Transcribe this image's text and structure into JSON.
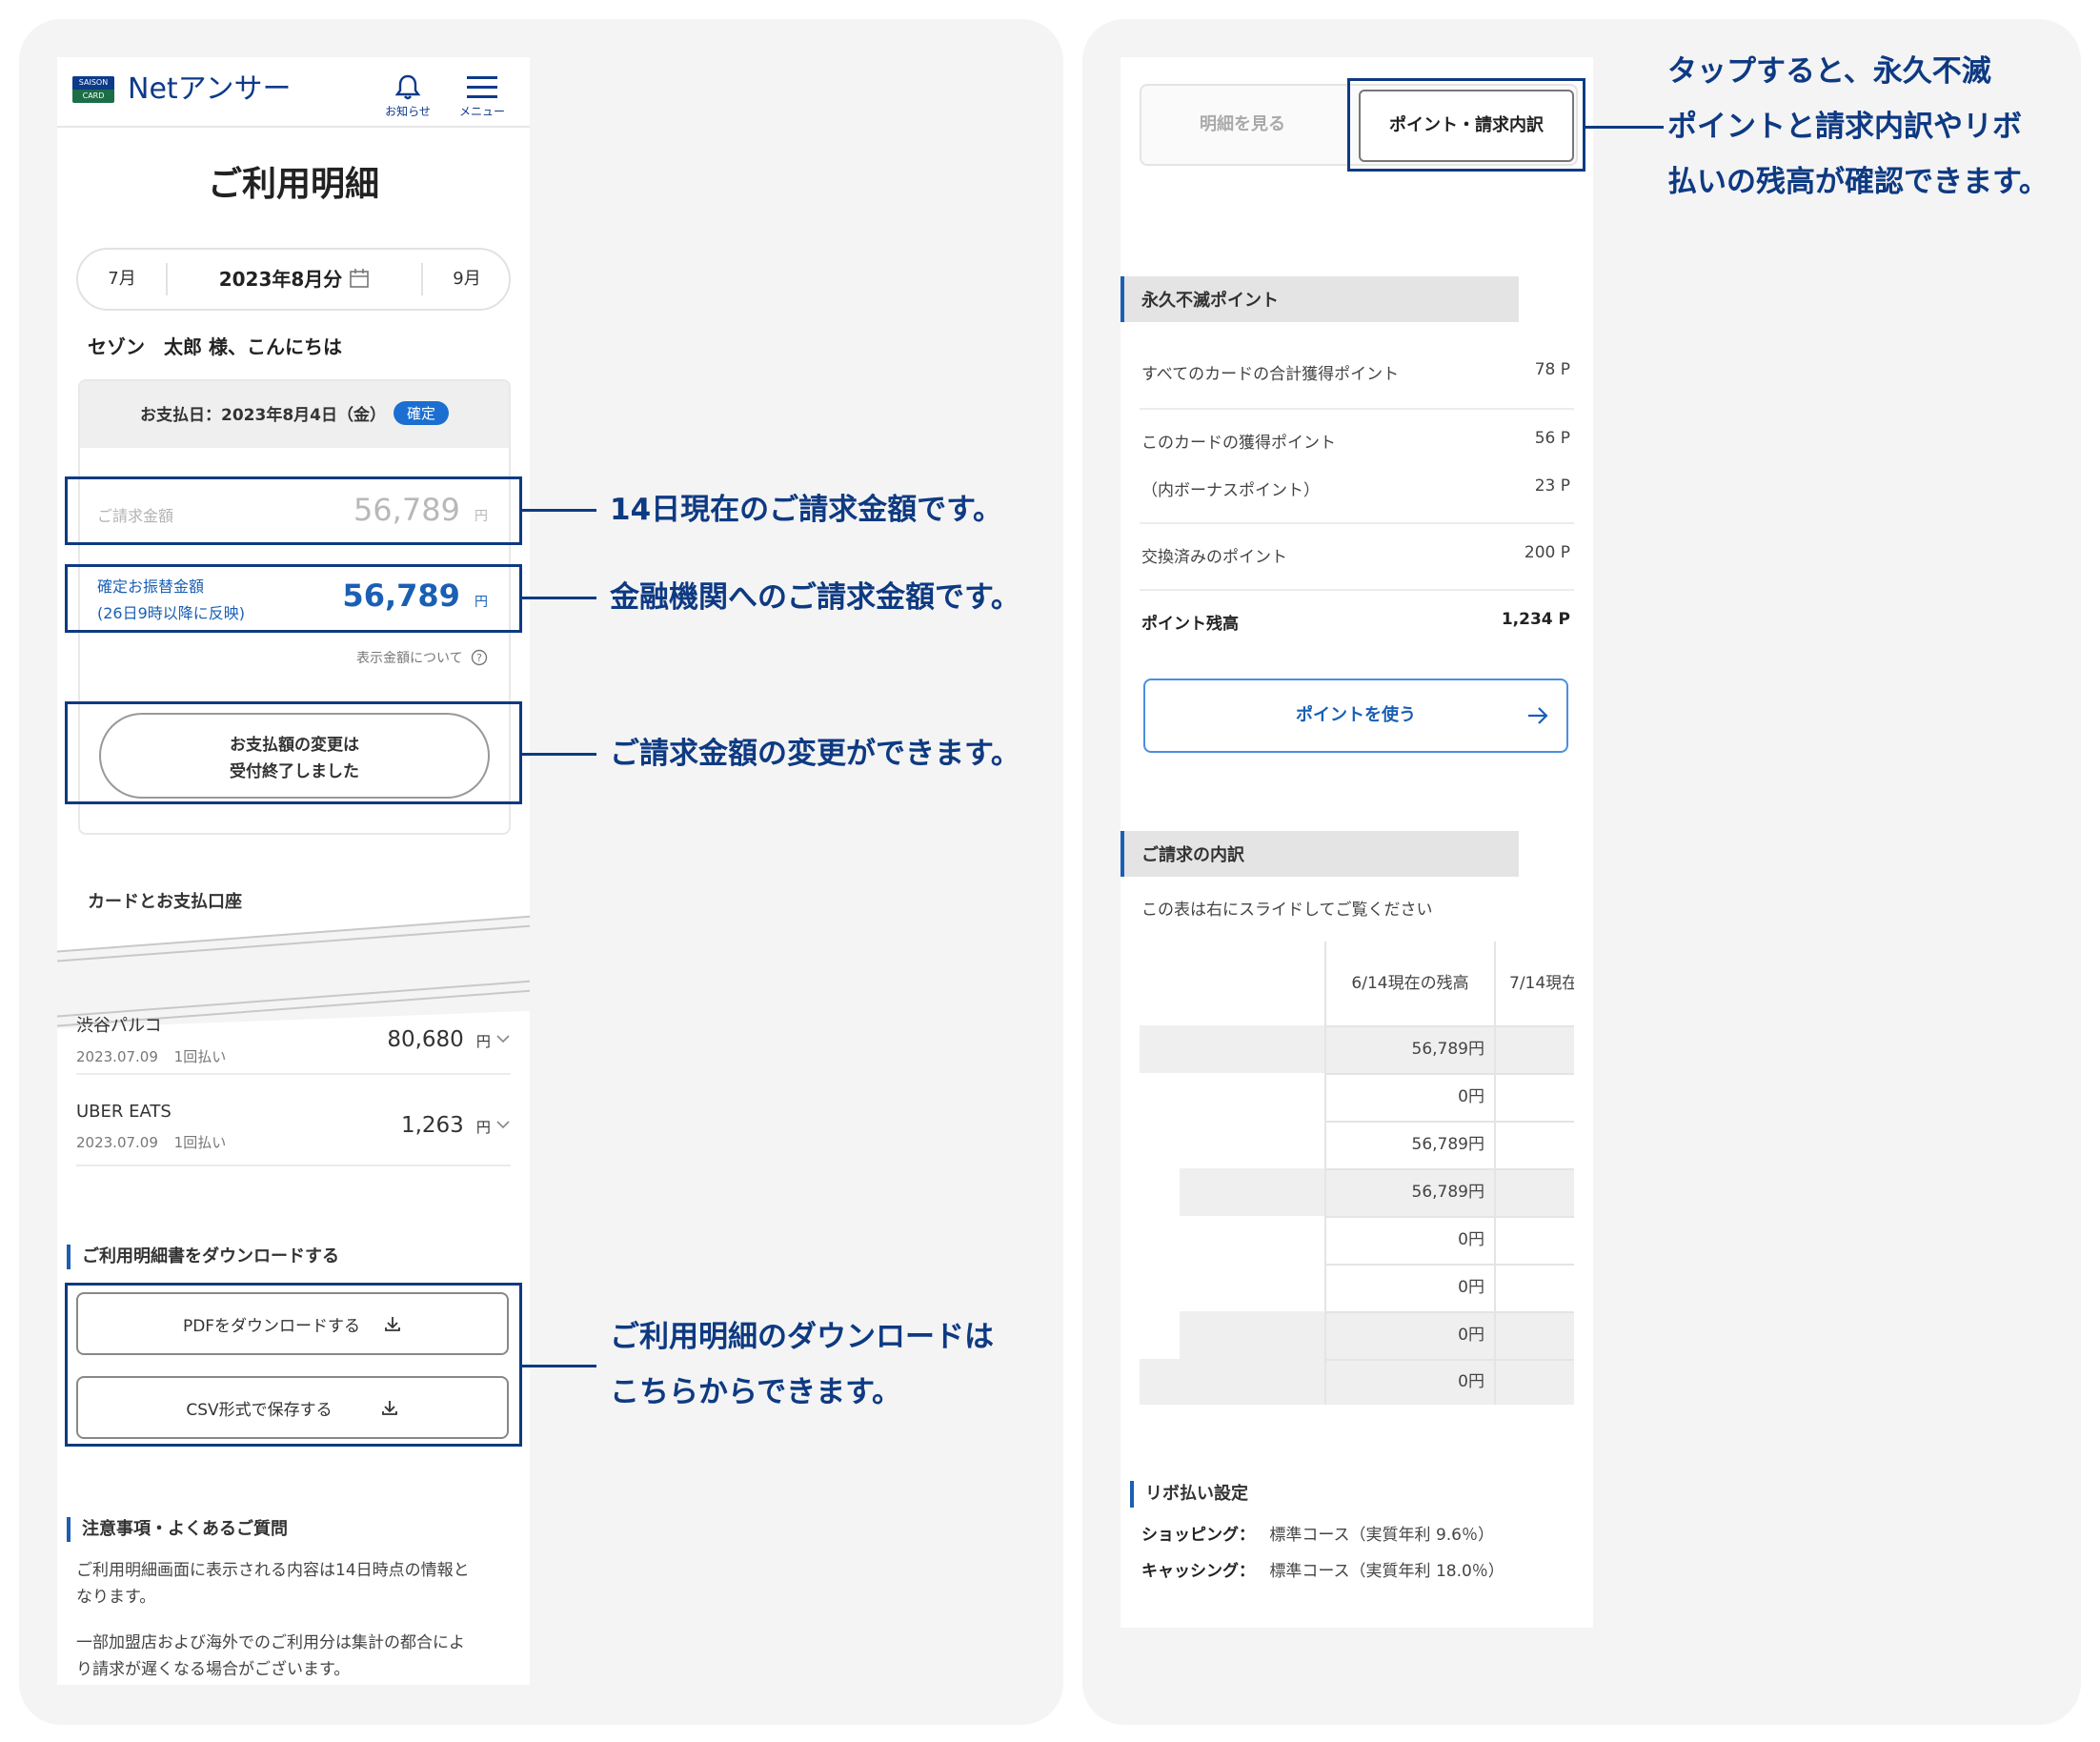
{
  "left": {
    "header": {
      "brand_top": "SAISON",
      "brand_bottom": "CARD",
      "app_name": "Netアンサー",
      "notice_label": "お知らせ",
      "menu_label": "メニュー"
    },
    "page_title": "ご利用明細",
    "month_nav": {
      "prev": "7月",
      "current": "2023年8月分",
      "next": "9月"
    },
    "greeting": "セゾン　太郎 様、こんにちは",
    "payment_day": {
      "label": "お支払日：2023年8月4日（金）",
      "badge": "確定"
    },
    "billing": {
      "label": "ご請求金額",
      "amount": "56,789",
      "unit": "円"
    },
    "transfer": {
      "label_line1": "確定お振替金額",
      "label_line2": "(26日9時以降に反映)",
      "amount": "56,789",
      "unit": "円"
    },
    "display_note": "表示金額について",
    "change_button": {
      "line1": "お支払額の変更は",
      "line2": "受付終了しました"
    },
    "card_section_title": "カードとお支払口座",
    "transactions": [
      {
        "name": "渋谷パルコ",
        "date": "2023.07.09",
        "type": "1回払い",
        "amount": "80,680",
        "unit": "円"
      },
      {
        "name": "UBER EATS",
        "date": "2023.07.09",
        "type": "1回払い",
        "amount": "1,263",
        "unit": "円"
      }
    ],
    "download": {
      "title": "ご利用明細書をダウンロードする",
      "pdf_label": "PDFをダウンロードする",
      "csv_label": "CSV形式で保存する"
    },
    "faq": {
      "title": "注意事項・よくあるご質問",
      "para1_line1": "ご利用明細画面に表示される内容は14日時点の情報と",
      "para1_line2": "なります。",
      "para2_line1": "一部加盟店および海外でのご利用分は集計の都合によ",
      "para2_line2": "り請求が遅くなる場合がございます。"
    }
  },
  "right": {
    "tabs": {
      "statement": "明細を見る",
      "points": "ポイント・請求内訳"
    },
    "points_section": {
      "title": "永久不滅ポイント",
      "rows": [
        {
          "label": "すべてのカードの合計獲得ポイント",
          "value": "78 P"
        },
        {
          "label": "このカードの獲得ポイント",
          "value": "56 P"
        },
        {
          "label": "（内ボーナスポイント）",
          "value": "23 P"
        },
        {
          "label": "交換済みのポイント",
          "value": "200 P"
        },
        {
          "label": "ポイント残高",
          "value": "1,234 P"
        }
      ],
      "use_button": "ポイントを使う"
    },
    "breakdown": {
      "title": "ご請求の内訳",
      "hint": "この表は右にスライドしてご覧ください",
      "col1": "6/14現在の残高",
      "col2": "7/14現在",
      "values": [
        "56,789円",
        "0円",
        "56,789円",
        "56,789円",
        "0円",
        "0円",
        "0円",
        "0円"
      ]
    },
    "revolving": {
      "title": "リボ払い設定",
      "shopping_label": "ショッピング：",
      "shopping_value": "標準コース（実質年利 9.6％）",
      "cashing_label": "キャッシング：",
      "cashing_value": "標準コース（実質年利 18.0％）"
    }
  },
  "callouts": {
    "billing": "14日現在のご請求金額です。",
    "transfer": "金融機関へのご請求金額です。",
    "change": "ご請求金額の変更ができます。",
    "download_line1": "ご利用明細のダウンロードは",
    "download_line2": "こちらからできます。",
    "tab_line1": "タップすると、永久不滅",
    "tab_line2": "ポイントと請求内訳やリボ",
    "tab_line3": "払いの残高が確認できます。"
  },
  "colors": {
    "navy": "#0e3a82",
    "accent_blue": "#1a5fb4",
    "panel_bg": "#f4f4f4"
  }
}
